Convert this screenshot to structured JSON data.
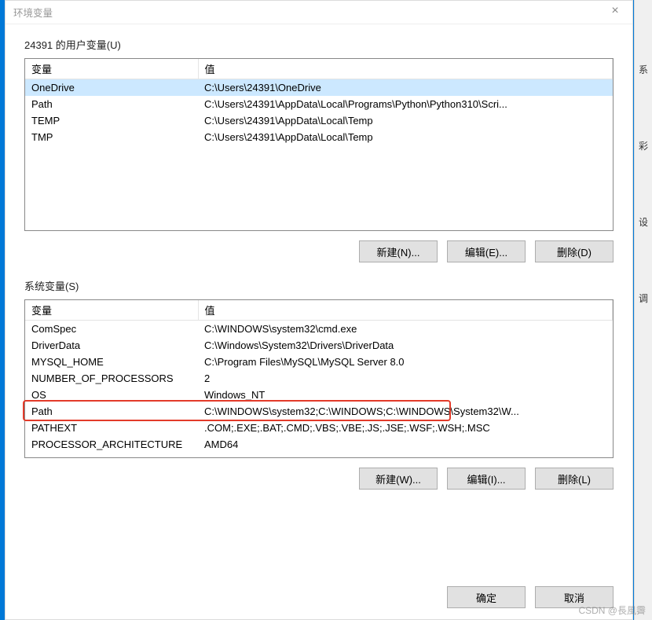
{
  "dialog": {
    "title": "环境变量",
    "close_icon": "×"
  },
  "user_vars": {
    "label": "24391 的用户变量(U)",
    "col_var": "变量",
    "col_val": "值",
    "rows": [
      {
        "name": "OneDrive",
        "value": "C:\\Users\\24391\\OneDrive"
      },
      {
        "name": "Path",
        "value": "C:\\Users\\24391\\AppData\\Local\\Programs\\Python\\Python310\\Scri..."
      },
      {
        "name": "TEMP",
        "value": "C:\\Users\\24391\\AppData\\Local\\Temp"
      },
      {
        "name": "TMP",
        "value": "C:\\Users\\24391\\AppData\\Local\\Temp"
      }
    ],
    "btn_new": "新建(N)...",
    "btn_edit": "编辑(E)...",
    "btn_delete": "删除(D)"
  },
  "sys_vars": {
    "label": "系统变量(S)",
    "col_var": "变量",
    "col_val": "值",
    "rows": [
      {
        "name": "ComSpec",
        "value": "C:\\WINDOWS\\system32\\cmd.exe"
      },
      {
        "name": "DriverData",
        "value": "C:\\Windows\\System32\\Drivers\\DriverData"
      },
      {
        "name": "MYSQL_HOME",
        "value": "C:\\Program Files\\MySQL\\MySQL Server 8.0"
      },
      {
        "name": "NUMBER_OF_PROCESSORS",
        "value": "2"
      },
      {
        "name": "OS",
        "value": "Windows_NT"
      },
      {
        "name": "Path",
        "value": "C:\\WINDOWS\\system32;C:\\WINDOWS;C:\\WINDOWS\\System32\\W..."
      },
      {
        "name": "PATHEXT",
        "value": ".COM;.EXE;.BAT;.CMD;.VBS;.VBE;.JS;.JSE;.WSF;.WSH;.MSC"
      },
      {
        "name": "PROCESSOR_ARCHITECTURE",
        "value": "AMD64"
      }
    ],
    "highlight_row": 5,
    "btn_new": "新建(W)...",
    "btn_edit": "编辑(I)...",
    "btn_delete": "删除(L)"
  },
  "dialog_buttons": {
    "ok": "确定",
    "cancel": "取消"
  },
  "watermark": "CSDN @長風霽",
  "right_labels": [
    "系",
    "彩",
    "设",
    "调"
  ]
}
